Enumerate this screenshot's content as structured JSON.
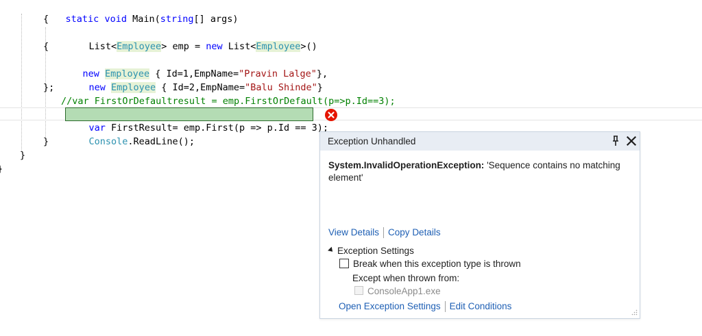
{
  "code": {
    "l1": {
      "k1": "static",
      "k2": "void",
      "t1": " Main(",
      "k3": "string",
      "t2": "[] args)"
    },
    "l2": "{",
    "l3": {
      "t1": "List<",
      "ty1": "Employee",
      "t2": "> emp = ",
      "k1": "new",
      "t3": " List<",
      "ty2": "Employee",
      "t4": ">()"
    },
    "l4": "{",
    "l5": {
      "k1": "new",
      "ty1": "Employee",
      "t1": " { Id=1,EmpName=",
      "s1": "\"Pravin Lalge\"",
      "t2": "},"
    },
    "l6": {
      "k1": "new",
      "ty1": "Employee",
      "t1": " { Id=2,EmpName=",
      "s1": "\"Balu Shinde\"",
      "t2": "}"
    },
    "l7": "};",
    "l8": "//var FirstOrDefaultresult = emp.FirstOrDefault(p=>p.Id==3);",
    "l9": {
      "k1": "var",
      "t1": " FirstResult= emp.First(p => p.Id == 3);"
    },
    "l10": {
      "ty1": "Console",
      "t1": ".ReadLine();"
    },
    "l11": "}",
    "l12": "}",
    "l13": "}"
  },
  "popup": {
    "title": "Exception Unhandled",
    "exception_type": "System.InvalidOperationException:",
    "exception_message": " 'Sequence contains no matching element'",
    "view_details": "View Details",
    "copy_details": "Copy Details",
    "settings_heading": "Exception Settings",
    "break_label": "Break when this exception type is thrown",
    "except_label": "Except when thrown from:",
    "module_label": "ConsoleApp1.exe",
    "open_settings": "Open Exception Settings",
    "edit_conditions": "Edit Conditions"
  },
  "colors": {
    "keyword": "#0000ff",
    "type": "#2b91af",
    "string": "#a31515",
    "comment": "#008000",
    "link": "#1e5fb4",
    "error": "#e51400"
  },
  "icons": [
    "error-icon",
    "pin-icon",
    "close-icon",
    "expand-triangle-icon",
    "resize-grip-icon"
  ]
}
